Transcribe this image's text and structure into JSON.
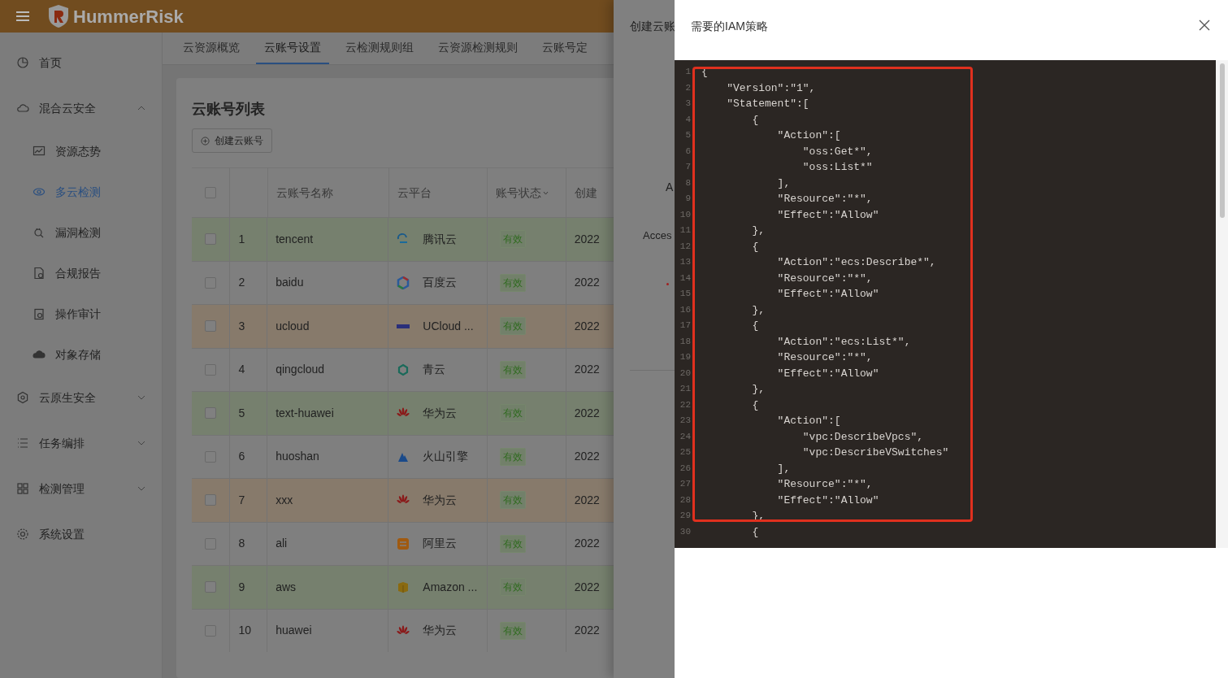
{
  "header": {
    "logo_text": "HummerRisk"
  },
  "sidebar": {
    "items": [
      {
        "label": "首页"
      },
      {
        "label": "混合云安全",
        "expanded": true,
        "children": [
          {
            "label": "资源态势",
            "selected": false
          },
          {
            "label": "多云检测",
            "selected": true
          },
          {
            "label": "漏洞检测",
            "selected": false
          },
          {
            "label": "合规报告",
            "selected": false
          },
          {
            "label": "操作审计",
            "selected": false
          },
          {
            "label": "对象存储",
            "selected": false
          }
        ]
      },
      {
        "label": "云原生安全",
        "expanded": false
      },
      {
        "label": "任务编排",
        "expanded": false
      },
      {
        "label": "检测管理",
        "expanded": false
      },
      {
        "label": "系统设置"
      }
    ]
  },
  "tabs": [
    {
      "label": "云资源概览",
      "selected": false
    },
    {
      "label": "云账号设置",
      "selected": true
    },
    {
      "label": "云检测规则组",
      "selected": false
    },
    {
      "label": "云资源检测规则",
      "selected": false
    },
    {
      "label": "云账号定",
      "selected": false
    }
  ],
  "card": {
    "title": "云账号列表",
    "create_button": "创建云账号",
    "select_all_checked": false,
    "columns": [
      "云账号名称",
      "云平台",
      "账号状态",
      "创建"
    ],
    "rows": [
      {
        "index": "1",
        "checked": false,
        "name": "tencent",
        "platform": "腾讯云",
        "kind": "tencent",
        "status": "有效",
        "created": "2022",
        "color": "#76806e"
      },
      {
        "index": "2",
        "checked": false,
        "name": "baidu",
        "platform": "百度云",
        "kind": "baidu",
        "status": "有效",
        "created": "2022"
      },
      {
        "index": "3",
        "checked": false,
        "name": "ucloud",
        "platform": "UCloud ...",
        "kind": "ucloud",
        "status": "有效",
        "created": "2022",
        "color": "#877a6b"
      },
      {
        "index": "4",
        "checked": false,
        "name": "qingcloud",
        "platform": "青云",
        "kind": "qingcloud",
        "status": "有效",
        "created": "2022"
      },
      {
        "index": "5",
        "checked": false,
        "name": "text-huawei",
        "platform": "华为云",
        "kind": "huawei",
        "status": "有效",
        "created": "2022",
        "color": "#76806e"
      },
      {
        "index": "6",
        "checked": false,
        "name": "huoshan",
        "platform": "火山引擎",
        "kind": "volcano",
        "status": "有效",
        "created": "2022"
      },
      {
        "index": "7",
        "checked": false,
        "name": "xxx",
        "platform": "华为云",
        "kind": "huawei",
        "status": "有效",
        "created": "2022",
        "color": "#877a6b"
      },
      {
        "index": "8",
        "checked": false,
        "name": "ali",
        "platform": "阿里云",
        "kind": "aliyun",
        "status": "有效",
        "created": "2022"
      },
      {
        "index": "9",
        "checked": false,
        "name": "aws",
        "platform": "Amazon ...",
        "kind": "aws",
        "status": "有效",
        "created": "2022",
        "color": "#76806e"
      },
      {
        "index": "10",
        "checked": false,
        "name": "huawei",
        "platform": "华为云",
        "kind": "huawei",
        "status": "有效",
        "created": "2022"
      }
    ]
  },
  "back_drawer": {
    "title": "创建云账",
    "label_1": "A",
    "label_2": "Acces"
  },
  "drawer": {
    "title": "需要的IAM策略",
    "code_lines": [
      {
        "number": "1",
        "text": "{"
      },
      {
        "number": "2",
        "text": "    \"Version\":\"1\","
      },
      {
        "number": "3",
        "text": "    \"Statement\":["
      },
      {
        "number": "4",
        "text": "        {"
      },
      {
        "number": "5",
        "text": "            \"Action\":["
      },
      {
        "number": "6",
        "text": "                \"oss:Get*\","
      },
      {
        "number": "7",
        "text": "                \"oss:List*\""
      },
      {
        "number": "8",
        "text": "            ],"
      },
      {
        "number": "9",
        "text": "            \"Resource\":\"*\","
      },
      {
        "number": "10",
        "text": "            \"Effect\":\"Allow\""
      },
      {
        "number": "11",
        "text": "        },"
      },
      {
        "number": "12",
        "text": "        {"
      },
      {
        "number": "13",
        "text": "            \"Action\":\"ecs:Describe*\","
      },
      {
        "number": "14",
        "text": "            \"Resource\":\"*\","
      },
      {
        "number": "15",
        "text": "            \"Effect\":\"Allow\""
      },
      {
        "number": "16",
        "text": "        },"
      },
      {
        "number": "17",
        "text": "        {"
      },
      {
        "number": "18",
        "text": "            \"Action\":\"ecs:List*\","
      },
      {
        "number": "19",
        "text": "            \"Resource\":\"*\","
      },
      {
        "number": "20",
        "text": "            \"Effect\":\"Allow\""
      },
      {
        "number": "21",
        "text": "        },"
      },
      {
        "number": "22",
        "text": "        {"
      },
      {
        "number": "23",
        "text": "            \"Action\":["
      },
      {
        "number": "24",
        "text": "                \"vpc:DescribeVpcs\","
      },
      {
        "number": "25",
        "text": "                \"vpc:DescribeVSwitches\""
      },
      {
        "number": "26",
        "text": "            ],"
      },
      {
        "number": "27",
        "text": "            \"Resource\":\"*\","
      },
      {
        "number": "28",
        "text": "            \"Effect\":\"Allow\""
      },
      {
        "number": "29",
        "text": "        },"
      },
      {
        "number": "30",
        "text": "        {"
      }
    ]
  }
}
